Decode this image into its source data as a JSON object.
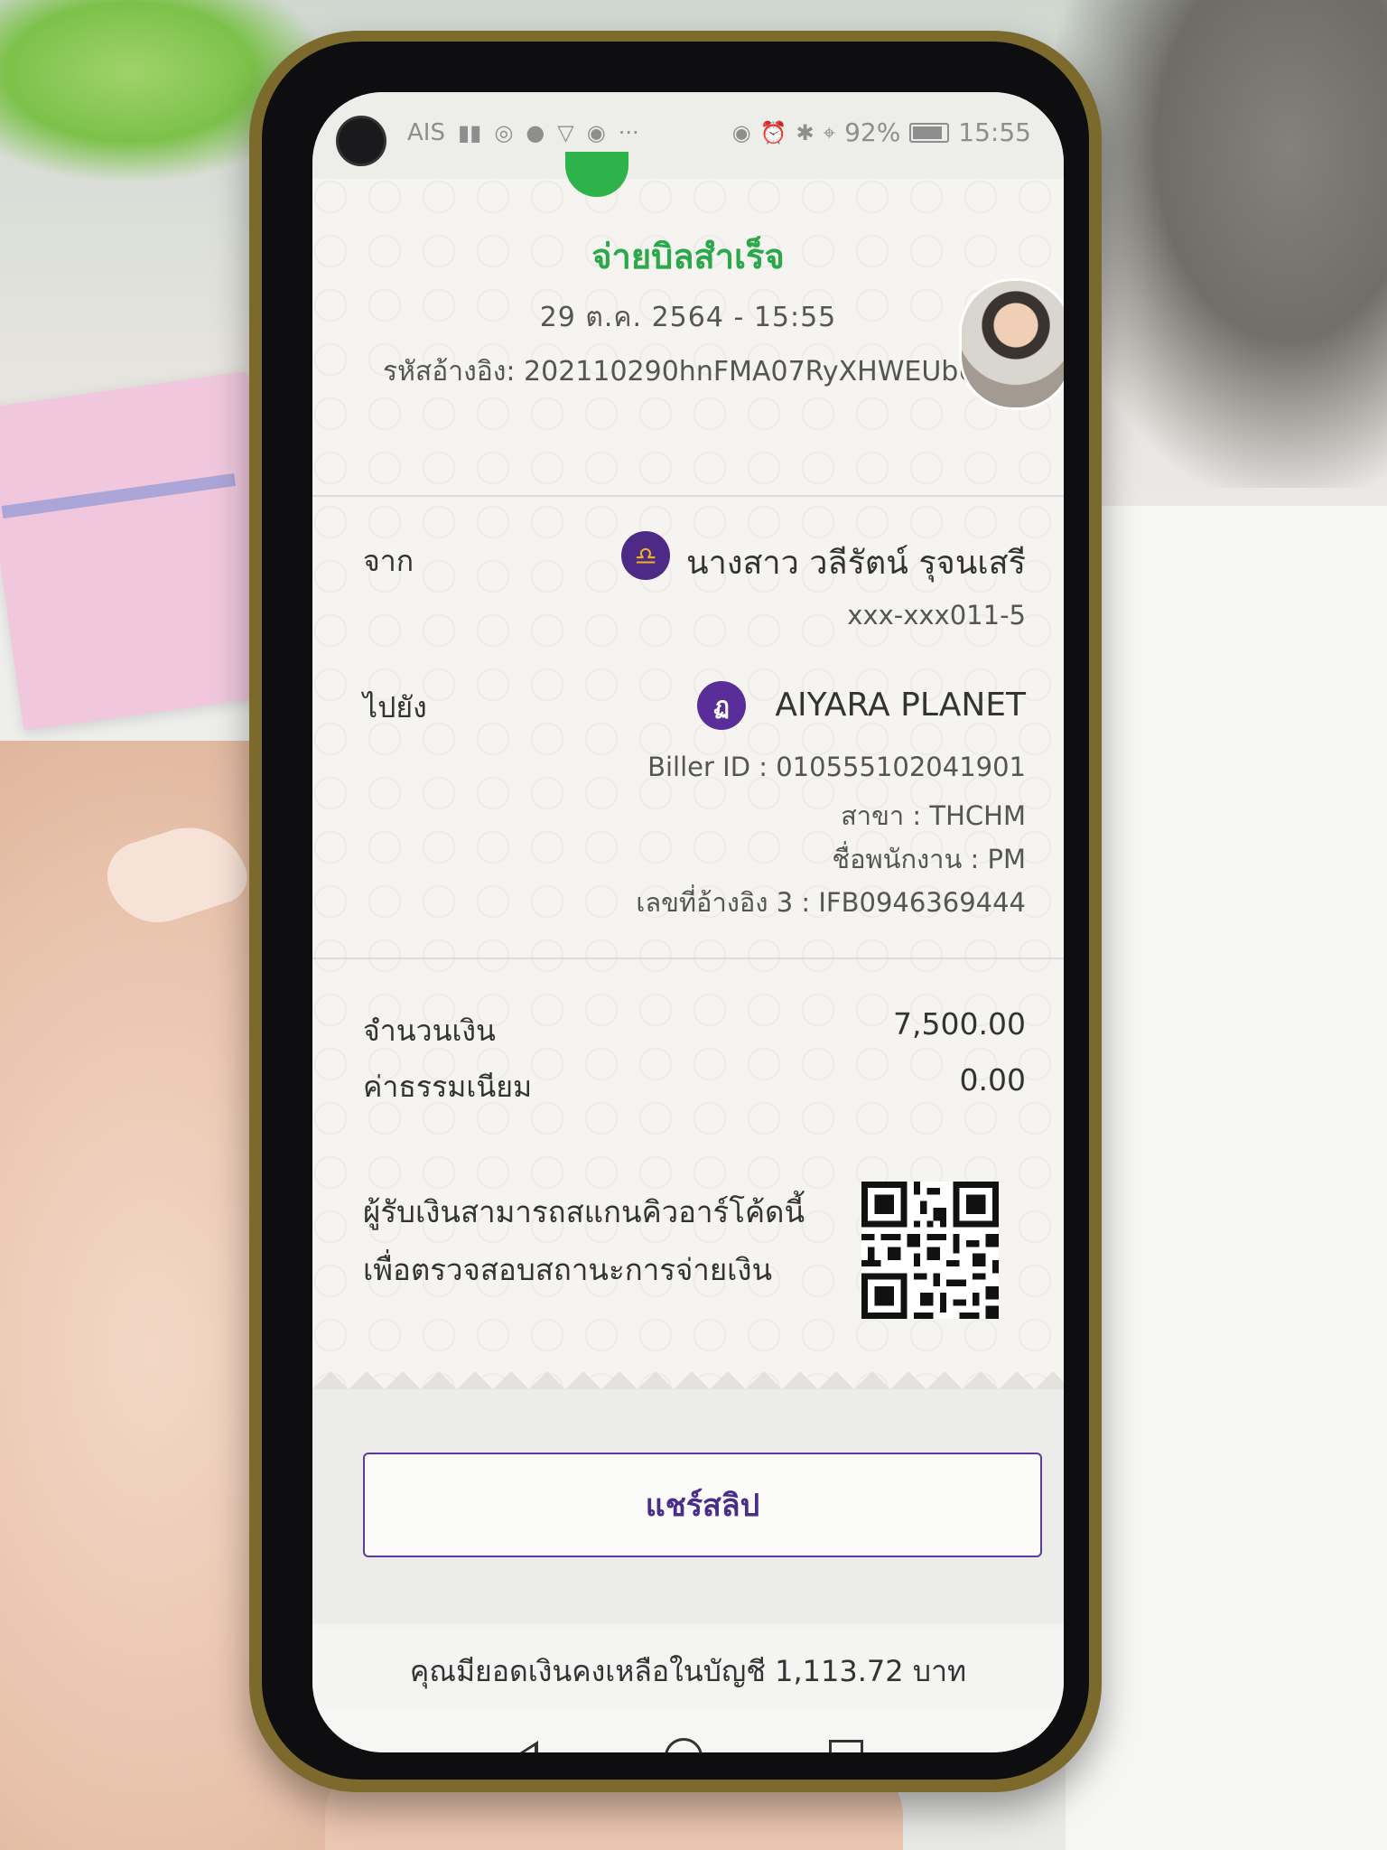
{
  "status_bar": {
    "carrier": "AIS",
    "battery": "92%",
    "time": "15:55"
  },
  "receipt": {
    "title": "จ่ายบิลสำเร็จ",
    "datetime": "29 ต.ค. 2564 - 15:55",
    "reference": "รหัสอ้างอิง: 202110290hnFMA07RyXHWEUbU",
    "from_label": "จาก",
    "from_name": "นางสาว วลีรัตน์ รุจนเสรี",
    "from_account": "xxx-xxx011-5",
    "to_label": "ไปยัง",
    "to_name": "AIYARA PLANET",
    "biller_id": "Biller ID : 010555102041901",
    "branch": "สาขา : THCHM",
    "employee": "ชื่อพนักงาน : PM",
    "reference3": "เลขที่อ้างอิง 3 : IFB0946369444",
    "amount_label": "จำนวนเงิน",
    "amount_value": "7,500.00",
    "fee_label": "ค่าธรรมเนียม",
    "fee_value": "0.00",
    "qr_text_line1": "ผู้รับเงินสามารถสแกนคิวอาร์โค้ดนี้",
    "qr_text_line2": "เพื่อตรวจสอบสถานะการจ่ายเงิน"
  },
  "actions": {
    "share_label": "แชร์สลิป"
  },
  "balance": {
    "text": "คุณมียอดเงินคงเหลือในบัญชี 1,113.72 บาท"
  },
  "colors": {
    "success_green": "#2aa84a",
    "brand_purple": "#4a2c8a"
  },
  "icons": {
    "bank": "scb-bank-icon",
    "biller": "biller-icon",
    "nav": [
      "back-icon",
      "home-icon",
      "recent-apps-icon"
    ]
  }
}
